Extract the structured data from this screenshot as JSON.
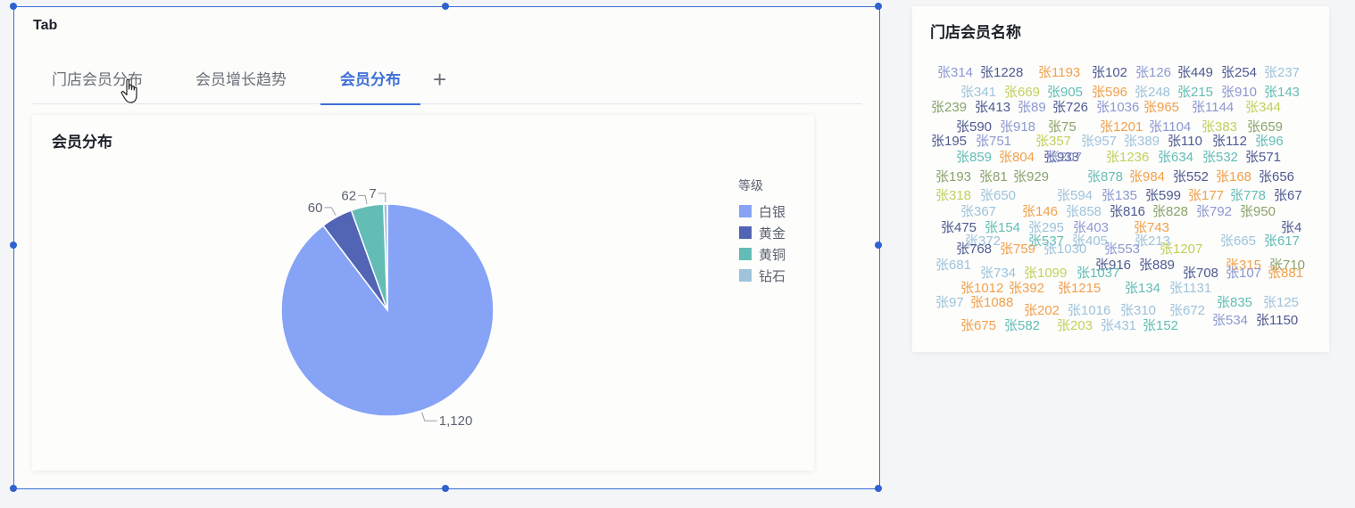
{
  "tab_widget": {
    "title": "Tab",
    "tabs": [
      "门店会员分布",
      "会员增长趋势",
      "会员分布"
    ],
    "active_tab": 2,
    "add_label": "+"
  },
  "chart": {
    "title": "会员分布",
    "legend_title": "等级"
  },
  "chart_data": {
    "type": "pie",
    "categories": [
      "白银",
      "黄金",
      "黄铜",
      "钻石"
    ],
    "values": [
      1120,
      60,
      62,
      7
    ],
    "value_labels": [
      "1,120",
      "60",
      "62",
      "7"
    ],
    "colors": [
      "#86a3f6",
      "#5264b4",
      "#63bdb6",
      "#9ec3db"
    ],
    "legend_placement": "top-right"
  },
  "word_cloud": {
    "title": "门店会员名称",
    "words": [
      [
        "张314",
        "#8d98d0"
      ],
      [
        "张1228",
        "#4f5a8f"
      ],
      [
        "张1193",
        "#f1a04b"
      ],
      [
        "张102",
        "#4f5a8f"
      ],
      [
        "张126",
        "#8d98d0"
      ],
      [
        "张449",
        "#4f5a8f"
      ],
      [
        "张254",
        "#4f5a8f"
      ],
      [
        "张237",
        "#9ec3db"
      ],
      [
        "张341",
        "#9ec3db"
      ],
      [
        "张669",
        "#c3cf5c"
      ],
      [
        "张905",
        "#63bdb6"
      ],
      [
        "张596",
        "#f1a04b"
      ],
      [
        "张248",
        "#9ec3db"
      ],
      [
        "张215",
        "#63bdb6"
      ],
      [
        "张910",
        "#8d98d0"
      ],
      [
        "张143",
        "#63bdb6"
      ],
      [
        "张239",
        "#8aa36b"
      ],
      [
        "张413",
        "#4f5a8f"
      ],
      [
        "张89",
        "#8d98d0"
      ],
      [
        "张726",
        "#4f5a8f"
      ],
      [
        "张1036",
        "#8d98d0"
      ],
      [
        "张965",
        "#f1a04b"
      ],
      [
        "张1144",
        "#8d98d0"
      ],
      [
        "张344",
        "#c3cf5c"
      ],
      [
        "张590",
        "#4f5a8f"
      ],
      [
        "张918",
        "#8d98d0"
      ],
      [
        "张75",
        "#8aa36b"
      ],
      [
        "张1201",
        "#f1a04b"
      ],
      [
        "张1104",
        "#8d98d0"
      ],
      [
        "张383",
        "#c3cf5c"
      ],
      [
        "张659",
        "#8aa36b"
      ],
      [
        "张195",
        "#4f5a8f"
      ],
      [
        "张751",
        "#8d98d0"
      ],
      [
        "张357",
        "#c3cf5c"
      ],
      [
        "张957",
        "#9ec3db"
      ],
      [
        "张389",
        "#9ec3db"
      ],
      [
        "张110",
        "#4f5a8f"
      ],
      [
        "张112",
        "#4f5a8f"
      ],
      [
        "张96",
        "#63bdb6"
      ],
      [
        "张859",
        "#63bdb6"
      ],
      [
        "张804",
        "#f1a04b"
      ],
      [
        "张933",
        "#4f5a8f"
      ],
      [
        "张1236",
        "#c3cf5c"
      ],
      [
        "张634",
        "#63bdb6"
      ],
      [
        "张532",
        "#63bdb6"
      ],
      [
        "张571",
        "#4f5a8f"
      ],
      [
        "张207",
        "#8d98d0"
      ],
      [
        "张193",
        "#8aa36b"
      ],
      [
        "张81",
        "#8aa36b"
      ],
      [
        "张929",
        "#8aa36b"
      ],
      [
        "张878",
        "#63bdb6"
      ],
      [
        "张984",
        "#f1a04b"
      ],
      [
        "张552",
        "#4f5a8f"
      ],
      [
        "张168",
        "#f1a04b"
      ],
      [
        "张656",
        "#4f5a8f"
      ],
      [
        "张318",
        "#c3cf5c"
      ],
      [
        "张650",
        "#9ec3db"
      ],
      [
        "张594",
        "#9ec3db"
      ],
      [
        "张135",
        "#8d98d0"
      ],
      [
        "张599",
        "#4f5a8f"
      ],
      [
        "张177",
        "#f1a04b"
      ],
      [
        "张778",
        "#63bdb6"
      ],
      [
        "张67",
        "#4f5a8f"
      ],
      [
        "张367",
        "#9ec3db"
      ],
      [
        "张146",
        "#f1a04b"
      ],
      [
        "张858",
        "#9ec3db"
      ],
      [
        "张816",
        "#4f5a8f"
      ],
      [
        "张828",
        "#8aa36b"
      ],
      [
        "张792",
        "#8d98d0"
      ],
      [
        "张950",
        "#8aa36b"
      ],
      [
        "张475",
        "#4f5a8f"
      ],
      [
        "张154",
        "#63bdb6"
      ],
      [
        "张295",
        "#9ec3db"
      ],
      [
        "张403",
        "#8d98d0"
      ],
      [
        "张743",
        "#f1a04b"
      ],
      [
        "张4",
        "#4f5a8f"
      ],
      [
        "张372",
        "#9ec3db"
      ],
      [
        "张537",
        "#63bdb6"
      ],
      [
        "张405",
        "#9ec3db"
      ],
      [
        "张213",
        "#9ec3db"
      ],
      [
        "张665",
        "#9ec3db"
      ],
      [
        "张617",
        "#63bdb6"
      ],
      [
        "张768",
        "#4f5a8f"
      ],
      [
        "张759",
        "#f1a04b"
      ],
      [
        "张1030",
        "#9ec3db"
      ],
      [
        "张553",
        "#8d98d0"
      ],
      [
        "张1207",
        "#c3cf5c"
      ],
      [
        "张681",
        "#9ec3db"
      ],
      [
        "张916",
        "#4f5a8f"
      ],
      [
        "张889",
        "#4f5a8f"
      ],
      [
        "张315",
        "#f1a04b"
      ],
      [
        "张710",
        "#8aa36b"
      ],
      [
        "张734",
        "#9ec3db"
      ],
      [
        "张1099",
        "#c3cf5c"
      ],
      [
        "张1037",
        "#63bdb6"
      ],
      [
        "张708",
        "#4f5a8f"
      ],
      [
        "张107",
        "#8d98d0"
      ],
      [
        "张881",
        "#f1a04b"
      ],
      [
        "张1012",
        "#f1a04b"
      ],
      [
        "张392",
        "#f1a04b"
      ],
      [
        "张1215",
        "#f1a04b"
      ],
      [
        "张134",
        "#63bdb6"
      ],
      [
        "张1131",
        "#9ec3db"
      ],
      [
        "张97",
        "#9ec3db"
      ],
      [
        "张1088",
        "#f1a04b"
      ],
      [
        "张835",
        "#63bdb6"
      ],
      [
        "张125",
        "#9ec3db"
      ],
      [
        "张202",
        "#f1a04b"
      ],
      [
        "张1016",
        "#9ec3db"
      ],
      [
        "张310",
        "#9ec3db"
      ],
      [
        "张672",
        "#9ec3db"
      ],
      [
        "张534",
        "#8d98d0"
      ],
      [
        "张1150",
        "#4f5a8f"
      ],
      [
        "张675",
        "#f1a04b"
      ],
      [
        "张582",
        "#63bdb6"
      ],
      [
        "张203",
        "#c3cf5c"
      ],
      [
        "张431",
        "#9ec3db"
      ],
      [
        "张152",
        "#63bdb6"
      ]
    ]
  }
}
